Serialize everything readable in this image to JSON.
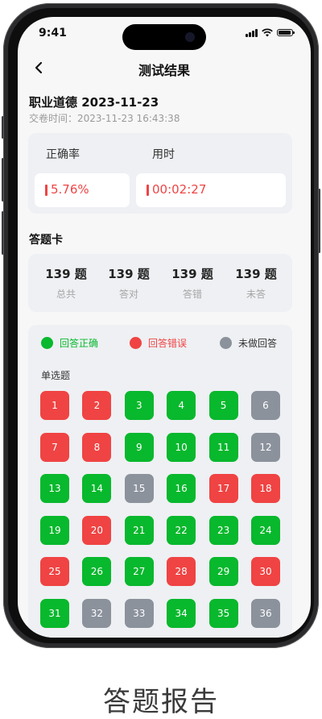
{
  "status_bar": {
    "time": "9:41"
  },
  "header": {
    "title": "测试结果"
  },
  "exam": {
    "title": "职业道德 2023-11-23",
    "submit_time": "交卷时间：2023-11-23 16:43:38"
  },
  "stats": {
    "accuracy_label": "正确率",
    "accuracy_value": "5.76%",
    "duration_label": "用时",
    "duration_value": "00:02:27"
  },
  "answer_card": {
    "title": "答题卡",
    "counts": [
      {
        "num": "139 题",
        "label": "总共"
      },
      {
        "num": "139 题",
        "label": "答对"
      },
      {
        "num": "139 题",
        "label": "答错"
      },
      {
        "num": "139 题",
        "label": "未答"
      }
    ],
    "legend": {
      "correct": "回答正确",
      "wrong": "回答错误",
      "unanswered": "未做回答"
    },
    "question_type": "单选题",
    "questions": [
      {
        "n": "1",
        "s": "wrong"
      },
      {
        "n": "2",
        "s": "wrong"
      },
      {
        "n": "3",
        "s": "correct"
      },
      {
        "n": "4",
        "s": "correct"
      },
      {
        "n": "5",
        "s": "correct"
      },
      {
        "n": "6",
        "s": "unanswered"
      },
      {
        "n": "7",
        "s": "wrong"
      },
      {
        "n": "8",
        "s": "wrong"
      },
      {
        "n": "9",
        "s": "correct"
      },
      {
        "n": "10",
        "s": "correct"
      },
      {
        "n": "11",
        "s": "correct"
      },
      {
        "n": "12",
        "s": "unanswered"
      },
      {
        "n": "13",
        "s": "correct"
      },
      {
        "n": "14",
        "s": "correct"
      },
      {
        "n": "15",
        "s": "unanswered"
      },
      {
        "n": "16",
        "s": "correct"
      },
      {
        "n": "17",
        "s": "wrong"
      },
      {
        "n": "18",
        "s": "wrong"
      },
      {
        "n": "19",
        "s": "correct"
      },
      {
        "n": "20",
        "s": "wrong"
      },
      {
        "n": "21",
        "s": "correct"
      },
      {
        "n": "22",
        "s": "correct"
      },
      {
        "n": "23",
        "s": "correct"
      },
      {
        "n": "24",
        "s": "correct"
      },
      {
        "n": "25",
        "s": "wrong"
      },
      {
        "n": "26",
        "s": "correct"
      },
      {
        "n": "27",
        "s": "correct"
      },
      {
        "n": "28",
        "s": "wrong"
      },
      {
        "n": "29",
        "s": "correct"
      },
      {
        "n": "30",
        "s": "wrong"
      },
      {
        "n": "31",
        "s": "correct"
      },
      {
        "n": "32",
        "s": "unanswered"
      },
      {
        "n": "33",
        "s": "unanswered"
      },
      {
        "n": "34",
        "s": "correct"
      },
      {
        "n": "35",
        "s": "correct"
      },
      {
        "n": "36",
        "s": "unanswered"
      }
    ]
  },
  "colors": {
    "correct": "#08b82d",
    "wrong": "#f04343",
    "unanswered": "#8b929c",
    "accent": "#ef4444"
  },
  "icons": {
    "back": "chevron-left-icon",
    "signal": "signal-icon",
    "wifi": "wifi-icon",
    "battery": "battery-icon"
  },
  "caption": "答题报告"
}
